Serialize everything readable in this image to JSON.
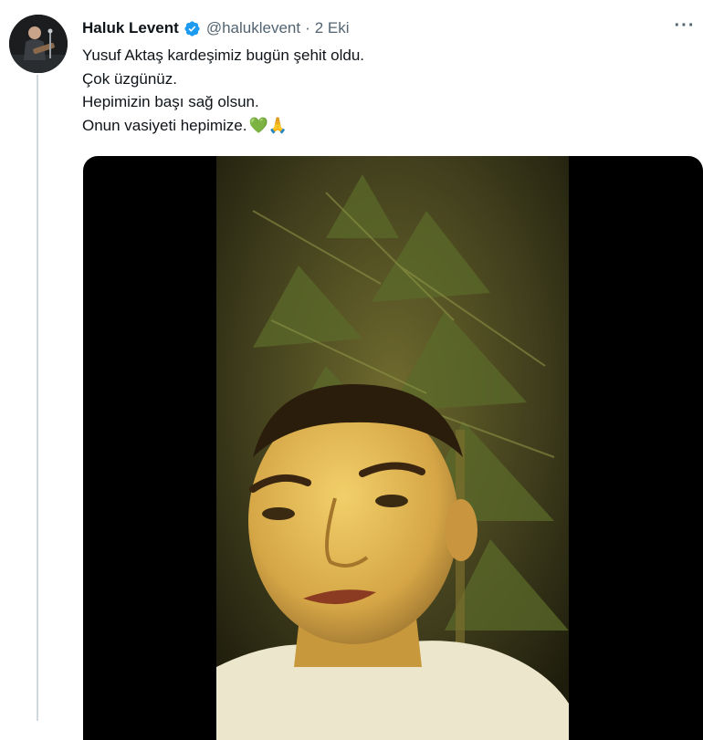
{
  "tweet": {
    "author_name": "Haluk Levent",
    "handle": "@haluklevent",
    "separator": "·",
    "date": "2 Eki",
    "more_label": "···",
    "lines": [
      "Yusuf Aktaş kardeşimiz bugün şehit oldu.",
      "Çok üzgünüz.",
      "Hepimizin başı sağ olsun.",
      "Onun vasiyeti hepimize."
    ],
    "emojis": "💚🙏",
    "verified": true
  },
  "icons": {
    "verified": "verified-badge-icon",
    "more": "more-options-icon"
  },
  "colors": {
    "verified_blue": "#1d9bf0",
    "secondary_text": "#536471",
    "thread_line": "#cfd9de",
    "media_bg": "#000000"
  }
}
